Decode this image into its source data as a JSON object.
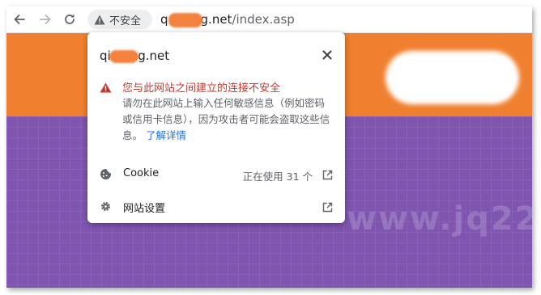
{
  "toolbar": {
    "security_label": "不安全",
    "url_host": "q",
    "url_host_rest": "g.net",
    "url_path": "/index.asp"
  },
  "popup": {
    "host_start": "qi",
    "host_end": "ng.net",
    "warning_title": "您与此网站之间建立的连接不安全",
    "warning_body": "请勿在此网站上输入任何敏感信息（例如密码或信用卡信息），因为攻击者可能会盗取这些信息。",
    "learn_more": "了解详情",
    "cookie_label": "Cookie",
    "cookie_value": "正在使用 31 个",
    "site_settings_label": "网站设置"
  },
  "page": {
    "watermark": "www.jq22"
  },
  "colors": {
    "warning_red": "#d93025",
    "link_blue": "#1a73e8",
    "page_orange": "#f08030",
    "page_purple": "#7f55b0"
  },
  "icons": {
    "back": "back-arrow-icon",
    "forward": "forward-arrow-icon",
    "reload": "reload-icon",
    "security": "warning-triangle-icon",
    "close": "close-icon",
    "cookie": "cookie-icon",
    "settings": "gear-icon",
    "external": "open-in-new-icon"
  }
}
